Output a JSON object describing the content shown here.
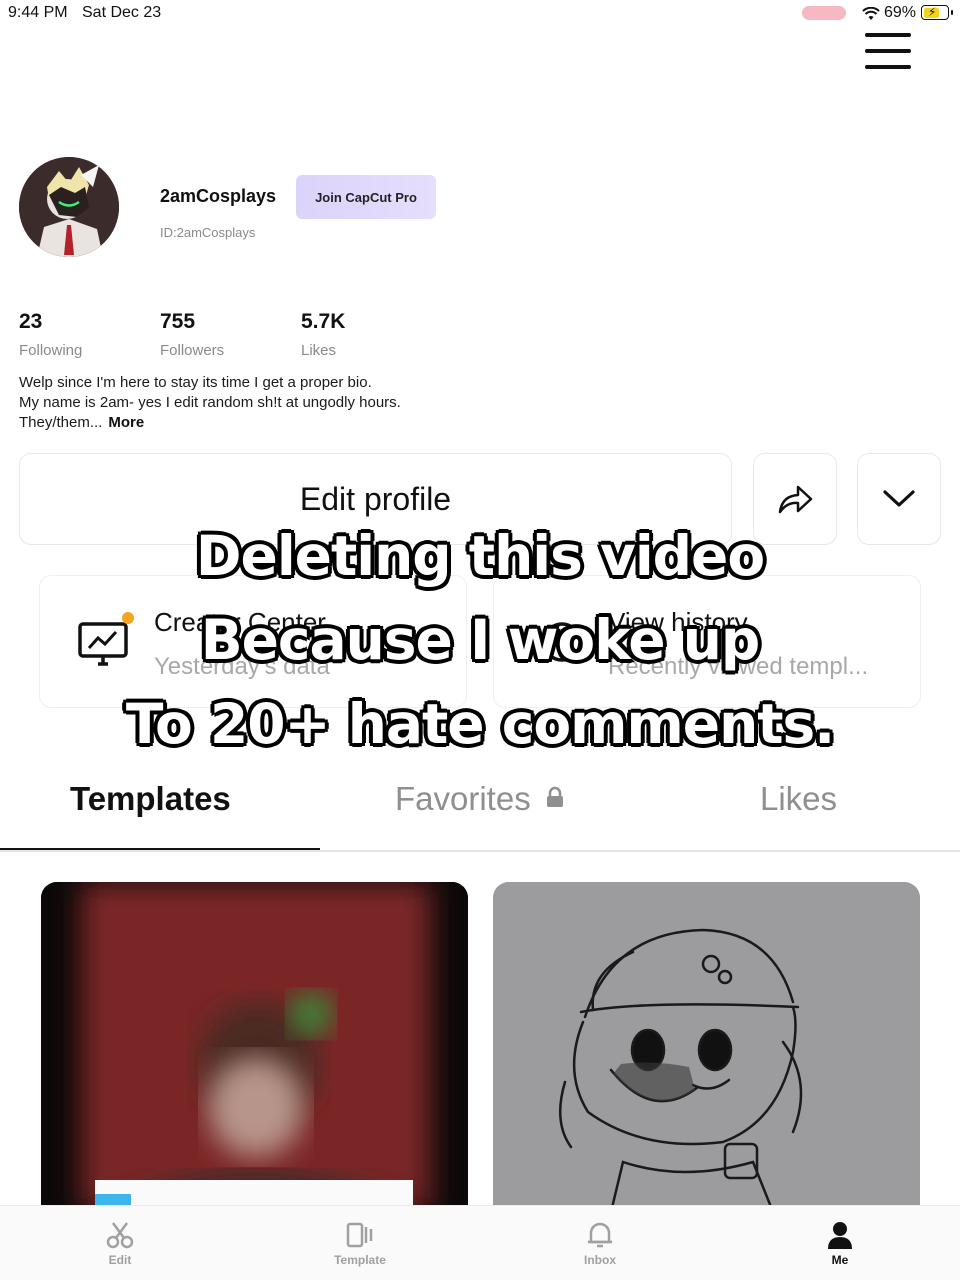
{
  "status_bar": {
    "time": "9:44 PM",
    "date": "Sat Dec 23",
    "battery": "69%",
    "battery_level": 0.69
  },
  "profile": {
    "username": "2amCosplays",
    "pro_button": "Join CapCut Pro",
    "id": "ID:2amCosplays",
    "stats": [
      {
        "value": "23",
        "label": "Following"
      },
      {
        "value": "755",
        "label": "Followers"
      },
      {
        "value": "5.7K",
        "label": "Likes"
      }
    ],
    "bio_lines": [
      "Welp since I'm here to stay its time I get a proper bio.",
      "My name is 2am- yes I edit random sh!t at ungodly hours.",
      "They/them..."
    ],
    "bio_more": "More",
    "edit_button": "Edit profile"
  },
  "cards": [
    {
      "title": "Creator Center",
      "subtitle": "Yesterday's data",
      "icon": "monitor-chart-icon",
      "badge_color": "#f4a523"
    },
    {
      "title": "View history",
      "subtitle": "Recently viewed templ...",
      "icon": "clock-icon"
    }
  ],
  "caption_lines": [
    "Deleting this video",
    "Because I woke up",
    "To 20+ hate comments."
  ],
  "tabs": [
    {
      "label": "Templates",
      "active": true
    },
    {
      "label": "Favorites",
      "icon": "lock-icon"
    },
    {
      "label": "Likes"
    }
  ],
  "bottom_nav": [
    {
      "label": "Edit",
      "icon": "scissors-icon"
    },
    {
      "label": "Template",
      "icon": "template-icon"
    },
    {
      "label": "Inbox",
      "icon": "bell-icon"
    },
    {
      "label": "Me",
      "icon": "person-icon",
      "active": true
    }
  ],
  "colors": {
    "pro_gradient": "#dcd3fb",
    "active_text": "#111111",
    "muted_text": "#8a8a8a"
  }
}
